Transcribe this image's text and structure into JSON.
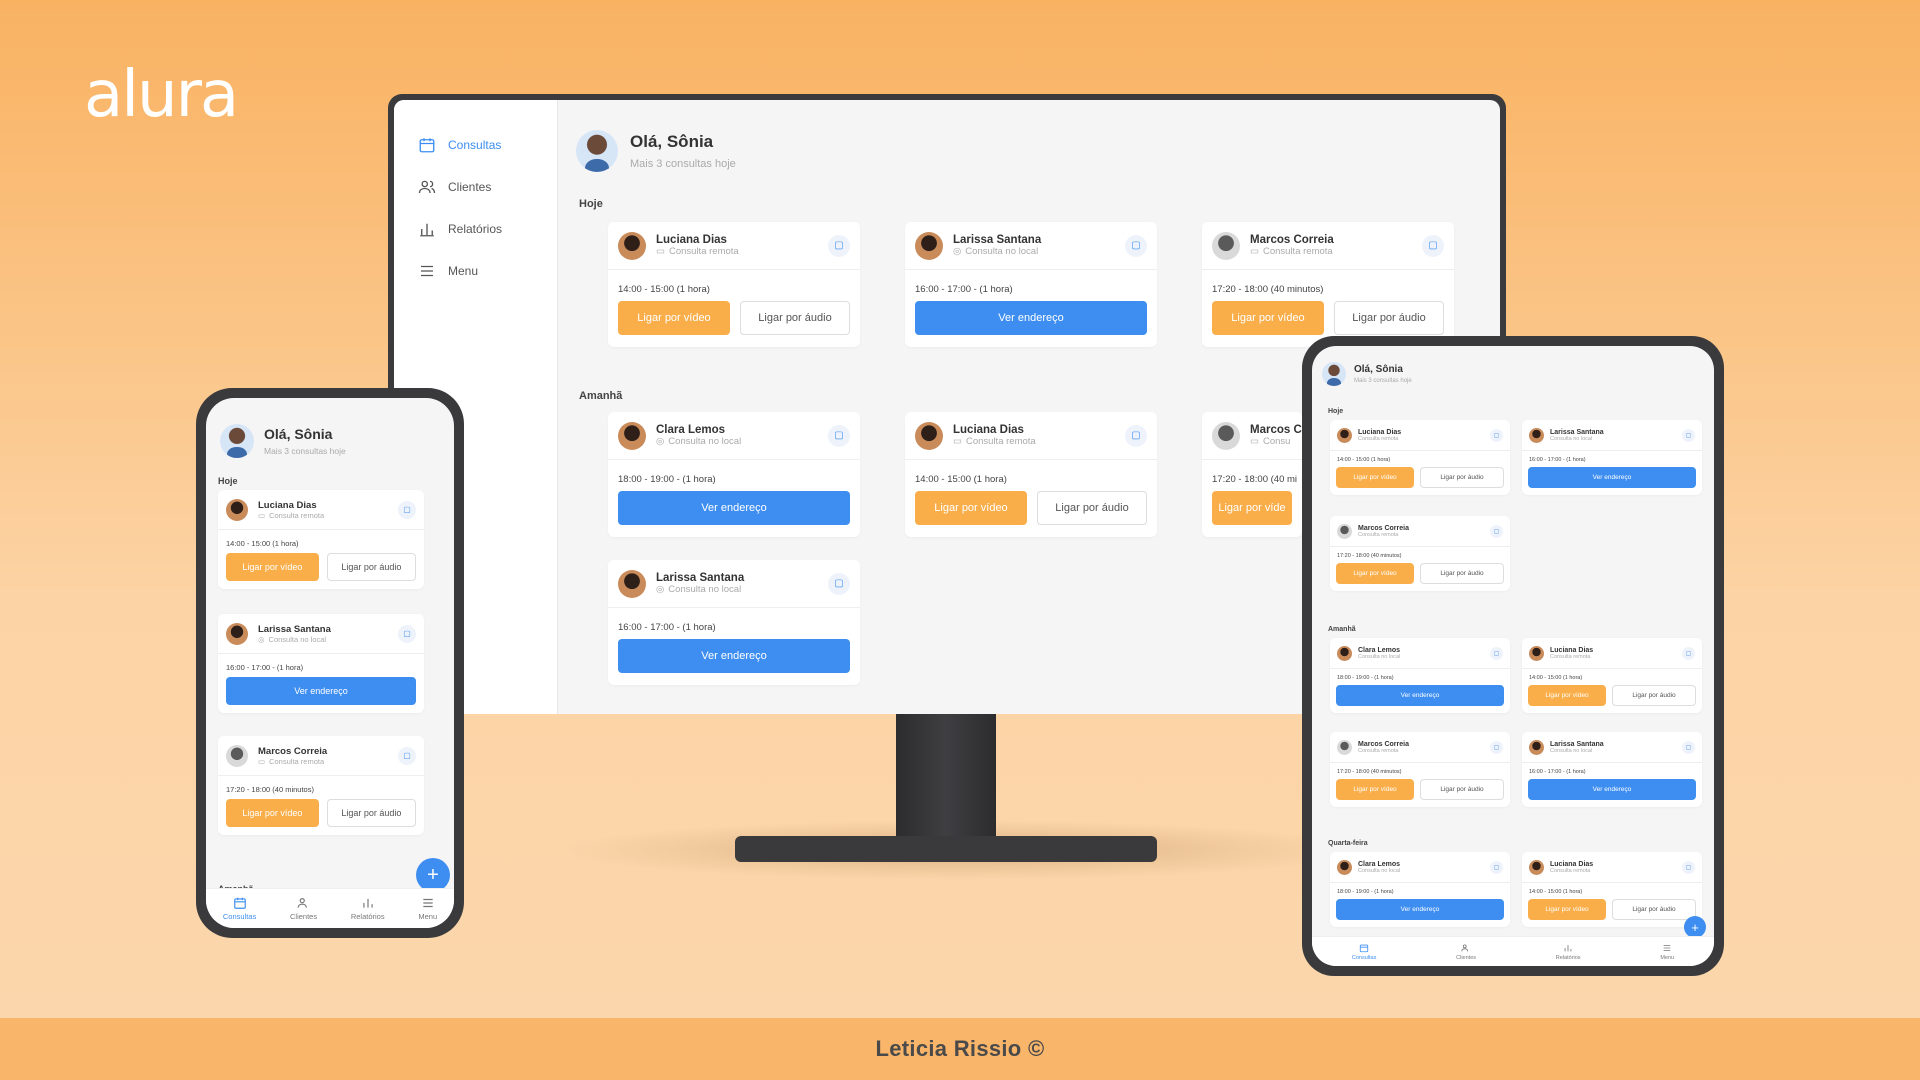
{
  "brand": {
    "logo_text": "alura",
    "credit": "Leticia Rissio ©",
    "colors": {
      "orange": "#f9ae4a",
      "blue": "#3d8ef0",
      "background": "#fcd3a4"
    }
  },
  "greeting": {
    "title": "Olá, Sônia",
    "subtitle": "Mais 3 consultas hoje"
  },
  "sidebar": {
    "items": [
      {
        "label": "Consultas",
        "icon": "calendar-icon"
      },
      {
        "label": "Clientes",
        "icon": "users-icon"
      },
      {
        "label": "Relatórios",
        "icon": "bar-chart-icon"
      },
      {
        "label": "Menu",
        "icon": "menu-icon"
      }
    ]
  },
  "sections": {
    "today": "Hoje",
    "tomorrow": "Amanhã",
    "wednesday": "Quarta-feira"
  },
  "buttons": {
    "video": "Ligar por vídeo",
    "audio": "Ligar por áudio",
    "address": "Ver endereço"
  },
  "types": {
    "remote": "Consulta remota",
    "local": "Consulta no local"
  },
  "appointments": {
    "luciana": {
      "name": "Luciana Dias",
      "time": "14:00 - 15:00 (1 hora)"
    },
    "larissa": {
      "name": "Larissa Santana",
      "time": "16:00 - 17:00 - (1 hora)"
    },
    "marcos": {
      "name": "Marcos Correia",
      "time": "17:20 - 18:00 (40 minutos)"
    },
    "clara": {
      "name": "Clara Lemos",
      "time": "18:00 - 19:00 - (1 hora)"
    },
    "marcos_cut": {
      "name": "Marcos C",
      "time": "17:20 - 18:00 (40 mi",
      "type": "Consu",
      "video": "Ligar por víde"
    }
  },
  "fab": {
    "label": "+"
  }
}
